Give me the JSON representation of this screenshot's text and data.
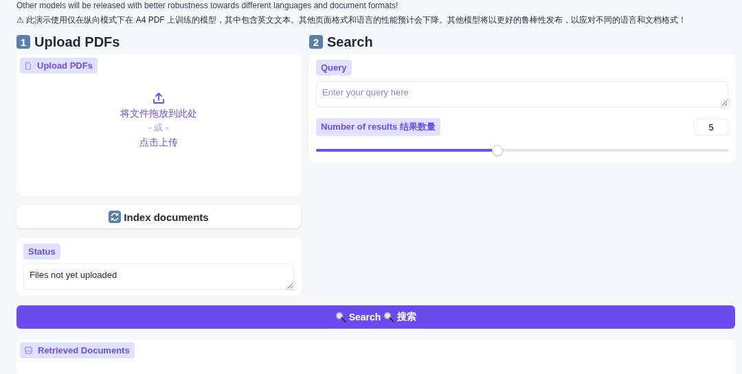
{
  "notes": [
    "Other models will be released with better robustness towards different languages and document formats!",
    "⚠ 此演示使用仅在纵向模式下在 A4 PDF 上训练的模型，其中包含英文文本。其他页面格式和语言的性能预计会下降。其他模型将以更好的鲁棒性发布，以应对不同的语言和文档格式！"
  ],
  "upload_section": {
    "number": "1",
    "title": "Upload PDFs",
    "dropzone": {
      "label": "Upload PDFs",
      "drop_text": "将文件拖放到此处",
      "or_text": "- 或 -",
      "click_text": "点击上传"
    },
    "index_button": "Index documents",
    "status": {
      "label": "Status",
      "value": "Files not yet uploaded"
    }
  },
  "search_section": {
    "number": "2",
    "title": "Search",
    "query": {
      "label": "Query",
      "placeholder": "Enter your query here"
    },
    "results": {
      "label": "Number of results 结果数量",
      "value": "5",
      "level": 0.44
    }
  },
  "search_button": {
    "parts": [
      "Search",
      "搜索"
    ]
  },
  "retrieved": {
    "label": "Retrieved Documents"
  }
}
